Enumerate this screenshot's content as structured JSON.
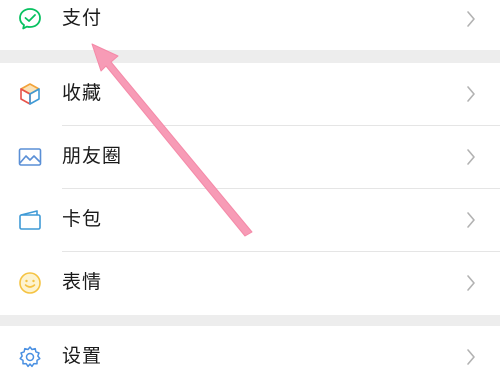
{
  "menu": {
    "pay": {
      "label": "支付",
      "icon": "pay-icon"
    },
    "favorites": {
      "label": "收藏",
      "icon": "favorites-cube-icon"
    },
    "moments": {
      "label": "朋友圈",
      "icon": "moments-picture-icon"
    },
    "cards": {
      "label": "卡包",
      "icon": "card-wallet-icon"
    },
    "stickers": {
      "label": "表情",
      "icon": "smiley-face-icon"
    },
    "settings": {
      "label": "设置",
      "icon": "gear-icon"
    }
  },
  "annotation": {
    "color": "#f79bb6",
    "icon": "arrow-annotation"
  },
  "colors": {
    "background": "#ededed",
    "card": "#ffffff",
    "text": "#1a1a1a",
    "chevron": "#b2b2b2",
    "pay_green": "#07c160",
    "favorites_orange": "#f2a33a",
    "moments_blue": "#5a8fd6",
    "cards_blue": "#3f9ad6",
    "stickers_yellow": "#f5c342",
    "settings_blue": "#4a90e2"
  }
}
